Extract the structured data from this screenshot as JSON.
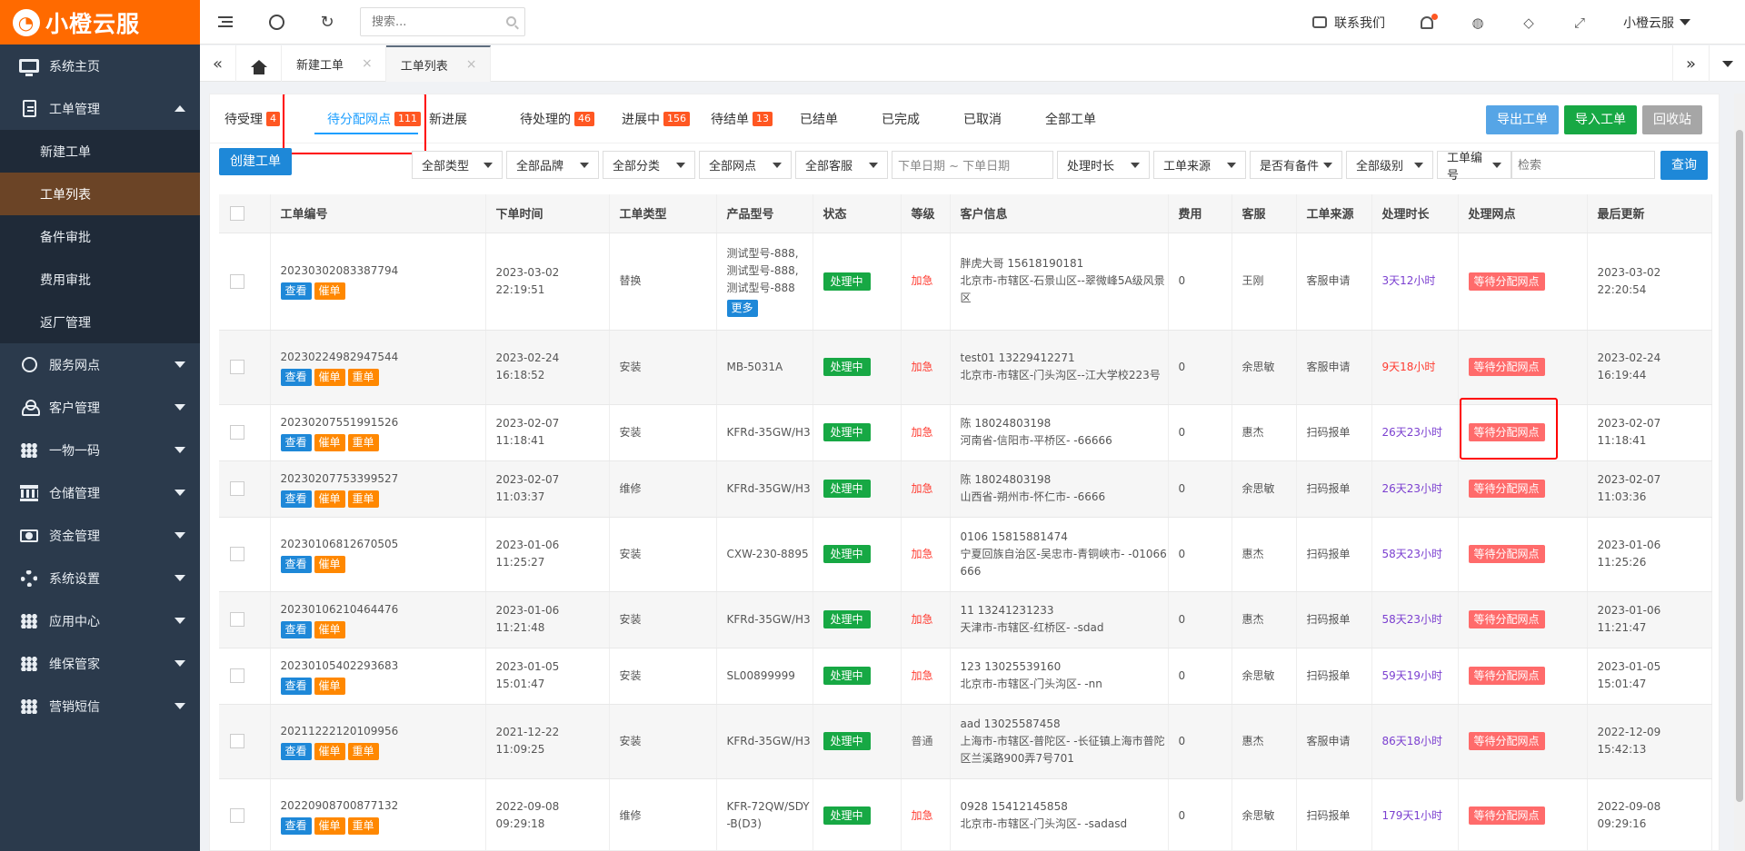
{
  "app": {
    "name": "小橙云服",
    "logo_glyph": "◔"
  },
  "sidebar": {
    "items": [
      {
        "label": "系统主页",
        "icon": "monitor-icon"
      },
      {
        "label": "工单管理",
        "icon": "document-icon",
        "expanded": true,
        "children": [
          "新建工单",
          "工单列表",
          "备件审批",
          "费用审批",
          "返厂管理"
        ],
        "active_child": "工单列表"
      },
      {
        "label": "服务网点",
        "icon": "globe-icon"
      },
      {
        "label": "客户管理",
        "icon": "user-icon"
      },
      {
        "label": "一物一码",
        "icon": "grid-icon"
      },
      {
        "label": "仓储管理",
        "icon": "bank-icon"
      },
      {
        "label": "资金管理",
        "icon": "money-icon"
      },
      {
        "label": "系统设置",
        "icon": "gear-icon"
      },
      {
        "label": "应用中心",
        "icon": "grid-icon"
      },
      {
        "label": "维保管家",
        "icon": "grid-icon"
      },
      {
        "label": "营销短信",
        "icon": "grid-icon"
      }
    ]
  },
  "topbar": {
    "search_placeholder": "搜索...",
    "contact_label": "联系我们",
    "user_name": "小橙云服"
  },
  "page_tabs": {
    "tabs": [
      {
        "label": "新建工单",
        "active": false
      },
      {
        "label": "工单列表",
        "active": true
      }
    ],
    "close_glyph": "×"
  },
  "status_tabs": [
    {
      "label": "待受理",
      "count": "4"
    },
    {
      "label": "待分配网点",
      "count": "111",
      "active": true
    },
    {
      "label": "新进展",
      "count": ""
    },
    {
      "label": "待处理的",
      "count": "46"
    },
    {
      "label": "进展中",
      "count": "156"
    },
    {
      "label": "待结单",
      "count": "13"
    },
    {
      "label": "已结单",
      "count": ""
    },
    {
      "label": "已完成",
      "count": ""
    },
    {
      "label": "已取消",
      "count": ""
    },
    {
      "label": "全部工单",
      "count": ""
    }
  ],
  "actions": {
    "export": "导出工单",
    "import": "导入工单",
    "recycle": "回收站",
    "create": "创建工单",
    "query": "查询"
  },
  "filters": {
    "selects": [
      "全部类型",
      "全部品牌",
      "全部分类",
      "全部网点",
      "全部客服"
    ],
    "date_range": "下单日期 ~ 下单日期",
    "selects2": [
      "处理时长",
      "工单来源",
      "是否有备件",
      "全部级别",
      "工单编号"
    ],
    "keyword_placeholder": "检索"
  },
  "table": {
    "headers": [
      "工单编号",
      "下单时间",
      "工单类型",
      "产品型号",
      "状态",
      "等级",
      "客户信息",
      "费用",
      "客服",
      "工单来源",
      "处理时长",
      "处理网点",
      "最后更新"
    ],
    "btn_view": "查看",
    "btn_urge": "催单",
    "btn_redo": "重单",
    "btn_more": "更多",
    "rows": [
      {
        "id": "20230302083387794",
        "date": "2023-03-02",
        "time": "22:19:51",
        "type": "替换",
        "model": "测试型号-888, 测试型号-888, 测试型号-888",
        "more": true,
        "status": "处理中",
        "level": "加急",
        "customer": "胖虎大哥 15618190181",
        "address": "北京市-市辖区-石景山区--翠微峰5A级风景区",
        "fee": "0",
        "agent": "王刚",
        "source": "客服申请",
        "duration": "3天12小时",
        "dur_red": false,
        "outlet": "等待分配网点",
        "upd_date": "2023-03-02",
        "upd_time": "22:20:54",
        "redo": false
      },
      {
        "id": "20230224982947544",
        "date": "2023-02-24",
        "time": "16:18:52",
        "type": "安装",
        "model": "MB-5031A",
        "more": false,
        "status": "处理中",
        "level": "加急",
        "customer": "test01 13229412271",
        "address": "北京市-市辖区-门头沟区--江大学校223号",
        "fee": "0",
        "agent": "余思敏",
        "source": "客服申请",
        "duration": "9天18小时",
        "dur_red": true,
        "outlet": "等待分配网点",
        "upd_date": "2023-02-24",
        "upd_time": "16:19:44",
        "redo": true
      },
      {
        "id": "20230207551991526",
        "date": "2023-02-07",
        "time": "11:18:41",
        "type": "安装",
        "model": "KFRd-35GW/H3",
        "more": false,
        "status": "处理中",
        "level": "加急",
        "customer": "陈 18024803198",
        "address": "河南省-信阳市-平桥区- -66666",
        "fee": "0",
        "agent": "惠杰",
        "source": "扫码报单",
        "duration": "26天23小时",
        "dur_red": false,
        "outlet": "等待分配网点",
        "upd_date": "2023-02-07",
        "upd_time": "11:18:41",
        "redo": true
      },
      {
        "id": "20230207753399527",
        "date": "2023-02-07",
        "time": "11:03:37",
        "type": "维修",
        "model": "KFRd-35GW/H3",
        "more": false,
        "status": "处理中",
        "level": "加急",
        "customer": "陈 18024803198",
        "address": "山西省-朔州市-怀仁市- -6666",
        "fee": "0",
        "agent": "余思敏",
        "source": "扫码报单",
        "duration": "26天23小时",
        "dur_red": false,
        "outlet": "等待分配网点",
        "upd_date": "2023-02-07",
        "upd_time": "11:03:36",
        "redo": true
      },
      {
        "id": "20230106812670505",
        "date": "2023-01-06",
        "time": "11:25:27",
        "type": "安装",
        "model": "CXW-230-8895",
        "more": false,
        "status": "处理中",
        "level": "加急",
        "customer": "0106 15815881474",
        "address": "宁夏回族自治区-吴忠市-青铜峡市- -01066666",
        "fee": "0",
        "agent": "惠杰",
        "source": "扫码报单",
        "duration": "58天23小时",
        "dur_red": false,
        "outlet": "等待分配网点",
        "upd_date": "2023-01-06",
        "upd_time": "11:25:26",
        "redo": false
      },
      {
        "id": "20230106210464476",
        "date": "2023-01-06",
        "time": "11:21:48",
        "type": "安装",
        "model": "KFRd-35GW/H3",
        "more": false,
        "status": "处理中",
        "level": "加急",
        "customer": "11 13241231233",
        "address": "天津市-市辖区-红桥区- -sdad",
        "fee": "0",
        "agent": "惠杰",
        "source": "扫码报单",
        "duration": "58天23小时",
        "dur_red": false,
        "outlet": "等待分配网点",
        "upd_date": "2023-01-06",
        "upd_time": "11:21:47",
        "redo": false
      },
      {
        "id": "20230105402293683",
        "date": "2023-01-05",
        "time": "15:01:47",
        "type": "安装",
        "model": "SL00899999",
        "more": false,
        "status": "处理中",
        "level": "加急",
        "customer": "123 13025539160",
        "address": "北京市-市辖区-门头沟区- -nn",
        "fee": "0",
        "agent": "余思敏",
        "source": "扫码报单",
        "duration": "59天19小时",
        "dur_red": false,
        "outlet": "等待分配网点",
        "upd_date": "2023-01-05",
        "upd_time": "15:01:47",
        "redo": false
      },
      {
        "id": "20211222120109956",
        "date": "2021-12-22",
        "time": "11:09:25",
        "type": "安装",
        "model": "KFRd-35GW/H3",
        "more": false,
        "status": "处理中",
        "level": "普通",
        "customer": "aad 13025587458",
        "address": "上海市-市辖区-普陀区- -长征镇上海市普陀区兰溪路900弄7号701",
        "fee": "0",
        "agent": "惠杰",
        "source": "客服申请",
        "duration": "86天18小时",
        "dur_red": false,
        "outlet": "等待分配网点",
        "upd_date": "2022-12-09",
        "upd_time": "15:42:13",
        "redo": true
      },
      {
        "id": "20220908700877132",
        "date": "2022-09-08",
        "time": "09:29:18",
        "type": "维修",
        "model": "KFR-72QW/SDY-B(D3)",
        "more": false,
        "status": "处理中",
        "level": "加急",
        "customer": "0928 15412145858",
        "address": "北京市-市辖区-门头沟区- -sadasd",
        "fee": "0",
        "agent": "余思敏",
        "source": "扫码报单",
        "duration": "179天1小时",
        "dur_red": false,
        "outlet": "等待分配网点",
        "upd_date": "2022-09-08",
        "upd_time": "09:29:16",
        "redo": true
      }
    ]
  }
}
